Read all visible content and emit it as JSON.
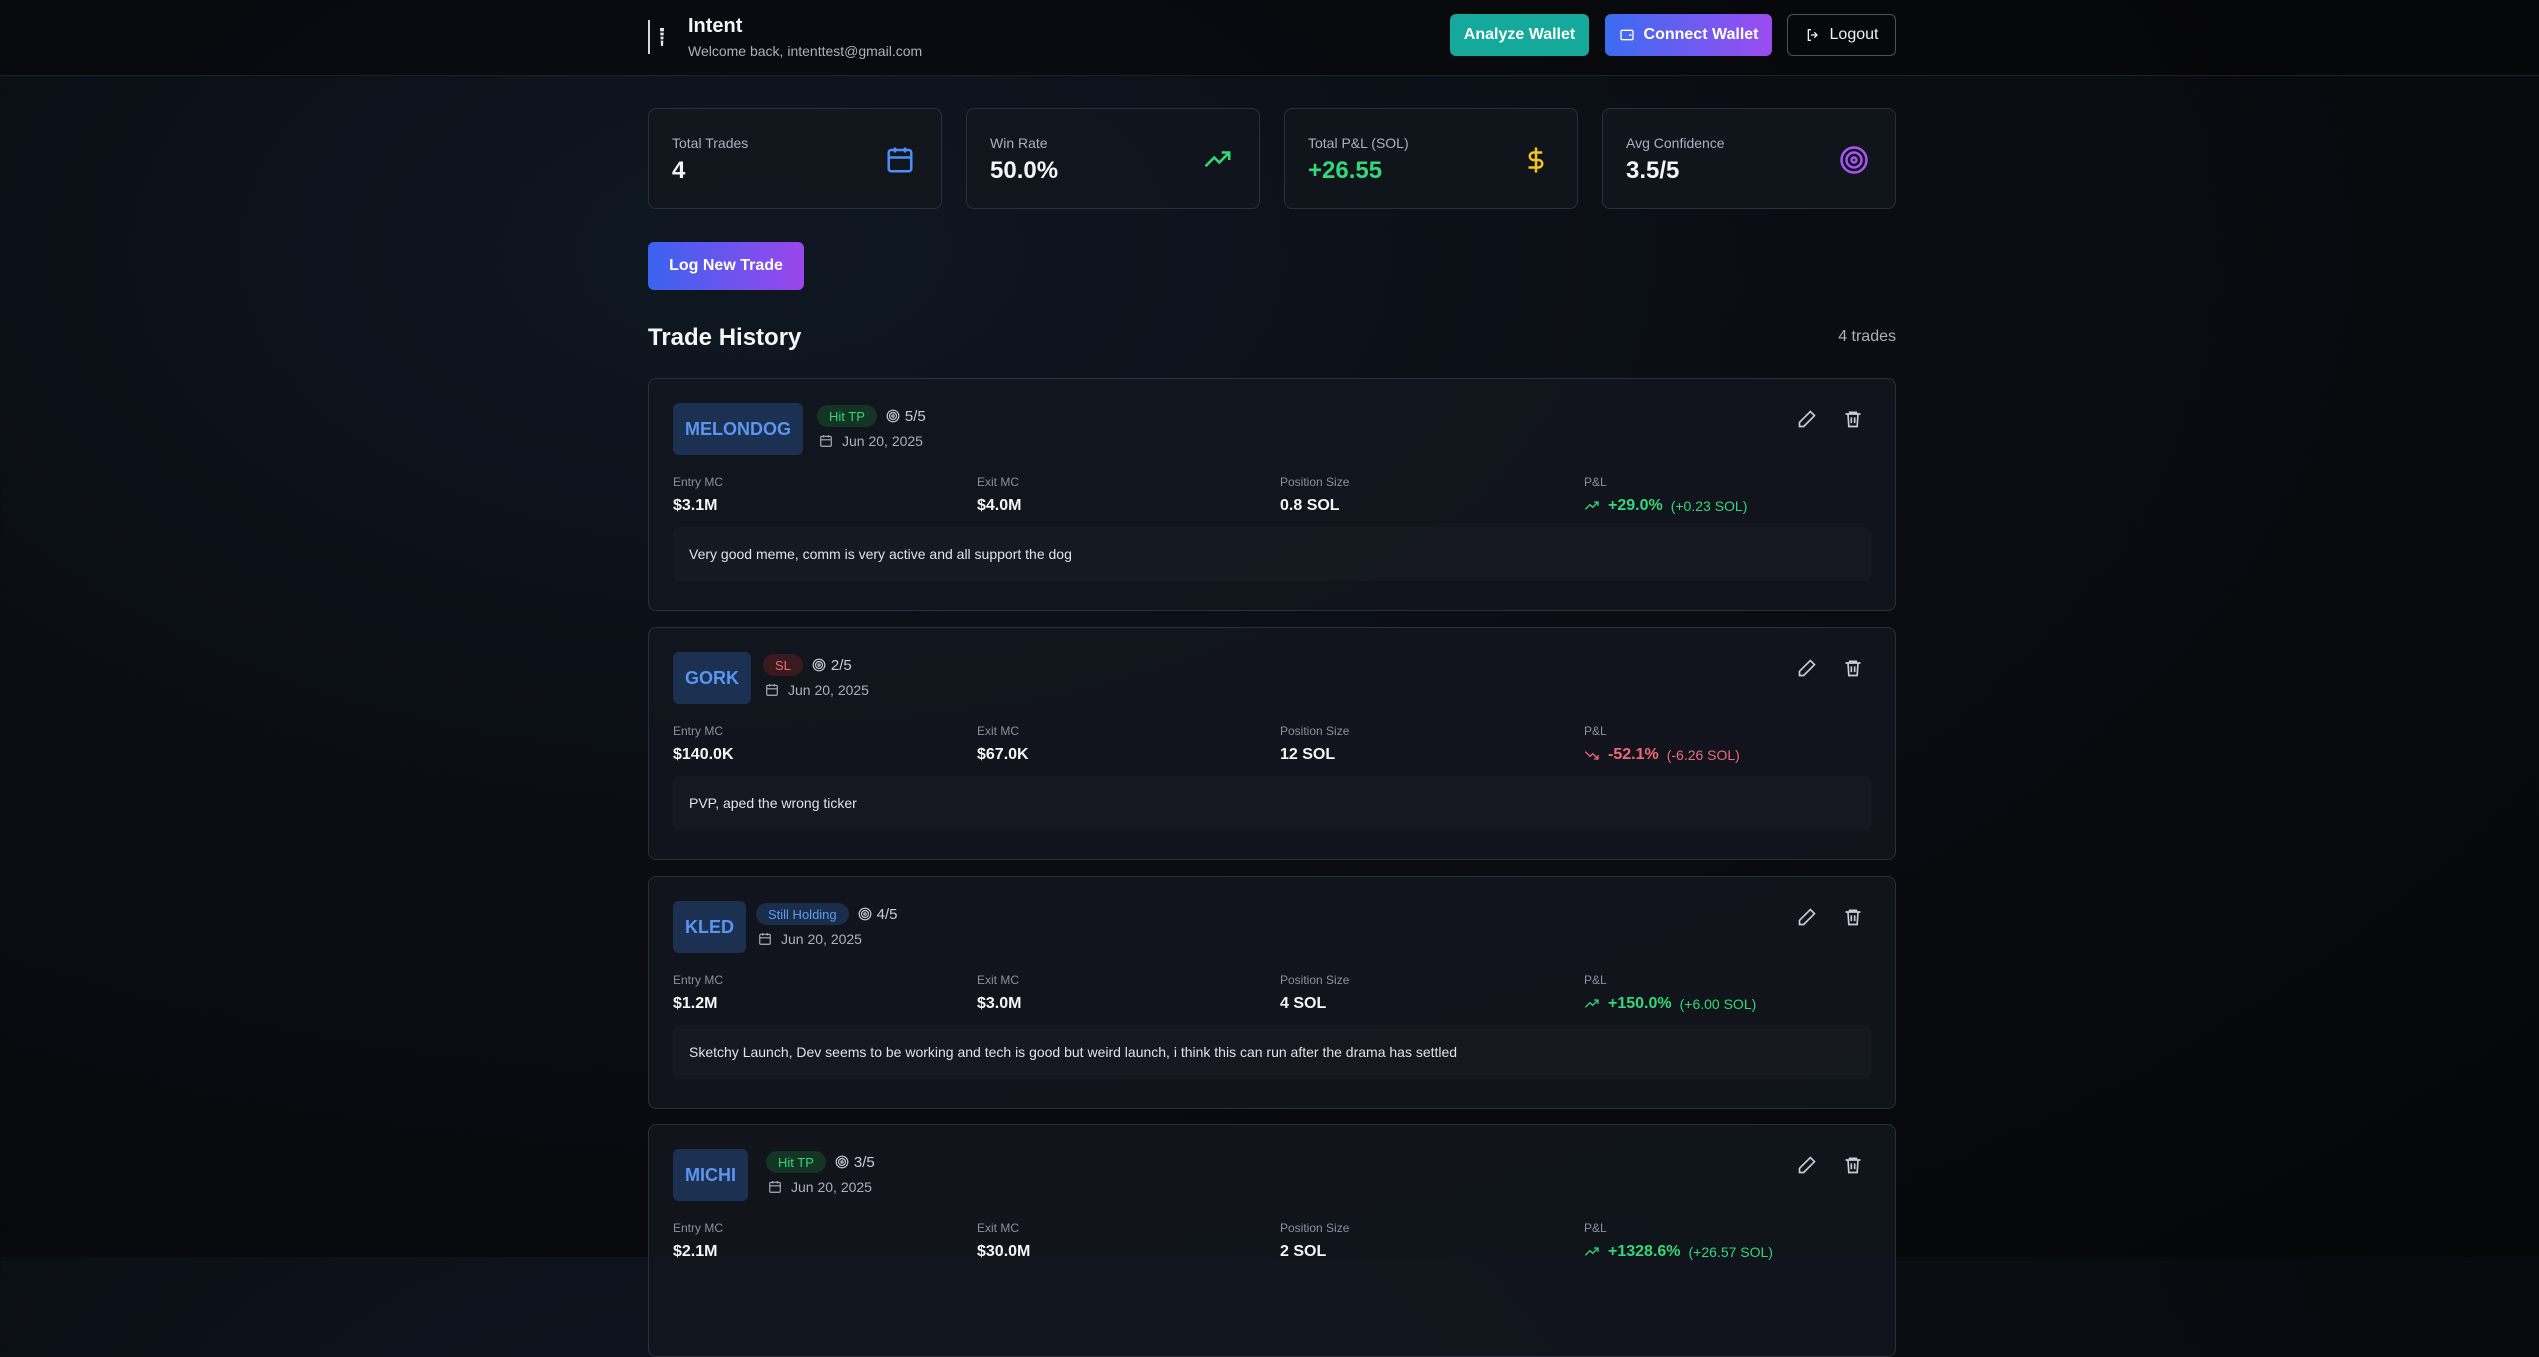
{
  "header": {
    "app_title": "Intent",
    "welcome": "Welcome back, intenttest@gmail.com",
    "analyze_label": "Analyze Wallet",
    "connect_label": "Connect Wallet",
    "logout_label": "Logout"
  },
  "stats": [
    {
      "label": "Total Trades",
      "value": "4",
      "icon": "calendar-icon",
      "color": "#4f8ef5"
    },
    {
      "label": "Win Rate",
      "value": "50.0%",
      "icon": "trending-up-icon",
      "color": "#34d87a"
    },
    {
      "label": "Total P&L (SOL)",
      "value": "+26.55",
      "icon": "dollar-icon",
      "color": "#f5c518"
    },
    {
      "label": "Avg Confidence",
      "value": "3.5/5",
      "icon": "target-icon",
      "color": "#a855f7"
    }
  ],
  "log_trade_label": "Log New Trade",
  "history": {
    "title": "Trade History",
    "count": "4 trades",
    "column_labels": {
      "entry": "Entry MC",
      "exit": "Exit MC",
      "size": "Position Size",
      "pnl": "P&L"
    }
  },
  "trades": [
    {
      "ticker": "MELONDOG",
      "status": "Hit TP",
      "confidence": "5/5",
      "date": "Jun 20, 2025",
      "entry": "$3.1M",
      "exit": "$4.0M",
      "size": "0.8 SOL",
      "pnl_pct": "+29.0%",
      "pnl_sol": "(+0.23 SOL)",
      "note": "Very good meme, comm is very active and all support the dog"
    },
    {
      "ticker": "GORK",
      "status": "SL",
      "confidence": "2/5",
      "date": "Jun 20, 2025",
      "entry": "$140.0K",
      "exit": "$67.0K",
      "size": "12 SOL",
      "pnl_pct": "-52.1%",
      "pnl_sol": "(-6.26 SOL)",
      "note": "PVP, aped the wrong ticker"
    },
    {
      "ticker": "KLED",
      "status": "Still Holding",
      "confidence": "4/5",
      "date": "Jun 20, 2025",
      "entry": "$1.2M",
      "exit": "$3.0M",
      "size": "4 SOL",
      "pnl_pct": "+150.0%",
      "pnl_sol": "(+6.00 SOL)",
      "note": "Sketchy Launch, Dev seems to be working and tech is good but weird launch, i think this can run after the drama has settled"
    },
    {
      "ticker": "MICHI",
      "status": "Hit TP",
      "confidence": "3/5",
      "date": "Jun 20, 2025",
      "entry": "$2.1M",
      "exit": "$30.0M",
      "size": "2 SOL",
      "pnl_pct": "+1328.6%",
      "pnl_sol": "(+26.57 SOL)"
    }
  ]
}
